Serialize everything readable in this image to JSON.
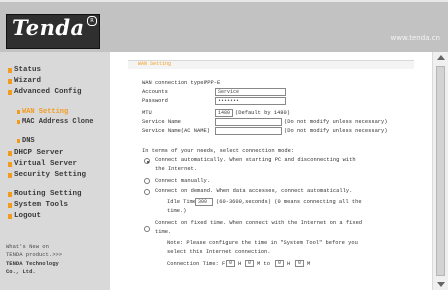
{
  "brand": {
    "name": "Tenda",
    "url": "www.tenda.cn"
  },
  "sidebar": {
    "items": [
      "Status",
      "Wizard",
      "Advanced Config",
      "DHCP Server",
      "Virtual Server",
      "Security Setting",
      "Routing Setting",
      "System Tools",
      "Logout"
    ],
    "advanced_sub": [
      "WAN Setting",
      "MAC Address Clone",
      "DNS"
    ],
    "active_sub": "WAN Setting",
    "promo_lines": [
      "What's New on",
      "TENDA product.>>>"
    ],
    "company": [
      "TENDA Technology",
      "Co., Ltd."
    ]
  },
  "page": {
    "section_title": "WAN Setting",
    "connection_type_label": "WAN connection type:",
    "connection_type_value": "PPP-E",
    "account_label": "Accounts",
    "account_value": "Service",
    "password_label": "Password",
    "password_value": "•••••••",
    "mtu_label": "MTU",
    "mtu_value": "1480",
    "mtu_hint": "(Default by 1480)",
    "service_name_label": "Service Name",
    "service_name_hint": "(Do not modify unless necessary)",
    "ac_name_label": "Service Name(AC NAME)",
    "ac_name_hint": "(Do not modify unless necessary)",
    "mode_intro": "In terms of your needs, select connection mode:",
    "modes": [
      "Connect automatically. When starting PC and disconnecting with",
      "the Internet.",
      "Connect manually.",
      "Connect on demand. When data accesses, connect automatically."
    ],
    "idle_time_label": "Idle Time:",
    "idle_time_value": "300",
    "idle_time_hint": "(60-3600,seconds) (0 means connecting all the",
    "idle_time_hint_2": "time.)",
    "fixed_time_label": "Connect on fixed time. When connect with the Internet on a fixed",
    "fixed_time_label_2": "time.",
    "note": "Note: Please configure the time in \"System Tool\" before you",
    "note_2": "select this Internet connection.",
    "connection_time_label": "Connection Time: From",
    "connection_time_values": [
      "0",
      "0",
      "0",
      "0"
    ],
    "connection_time_units": [
      "H",
      "M to",
      "H",
      "M"
    ]
  }
}
